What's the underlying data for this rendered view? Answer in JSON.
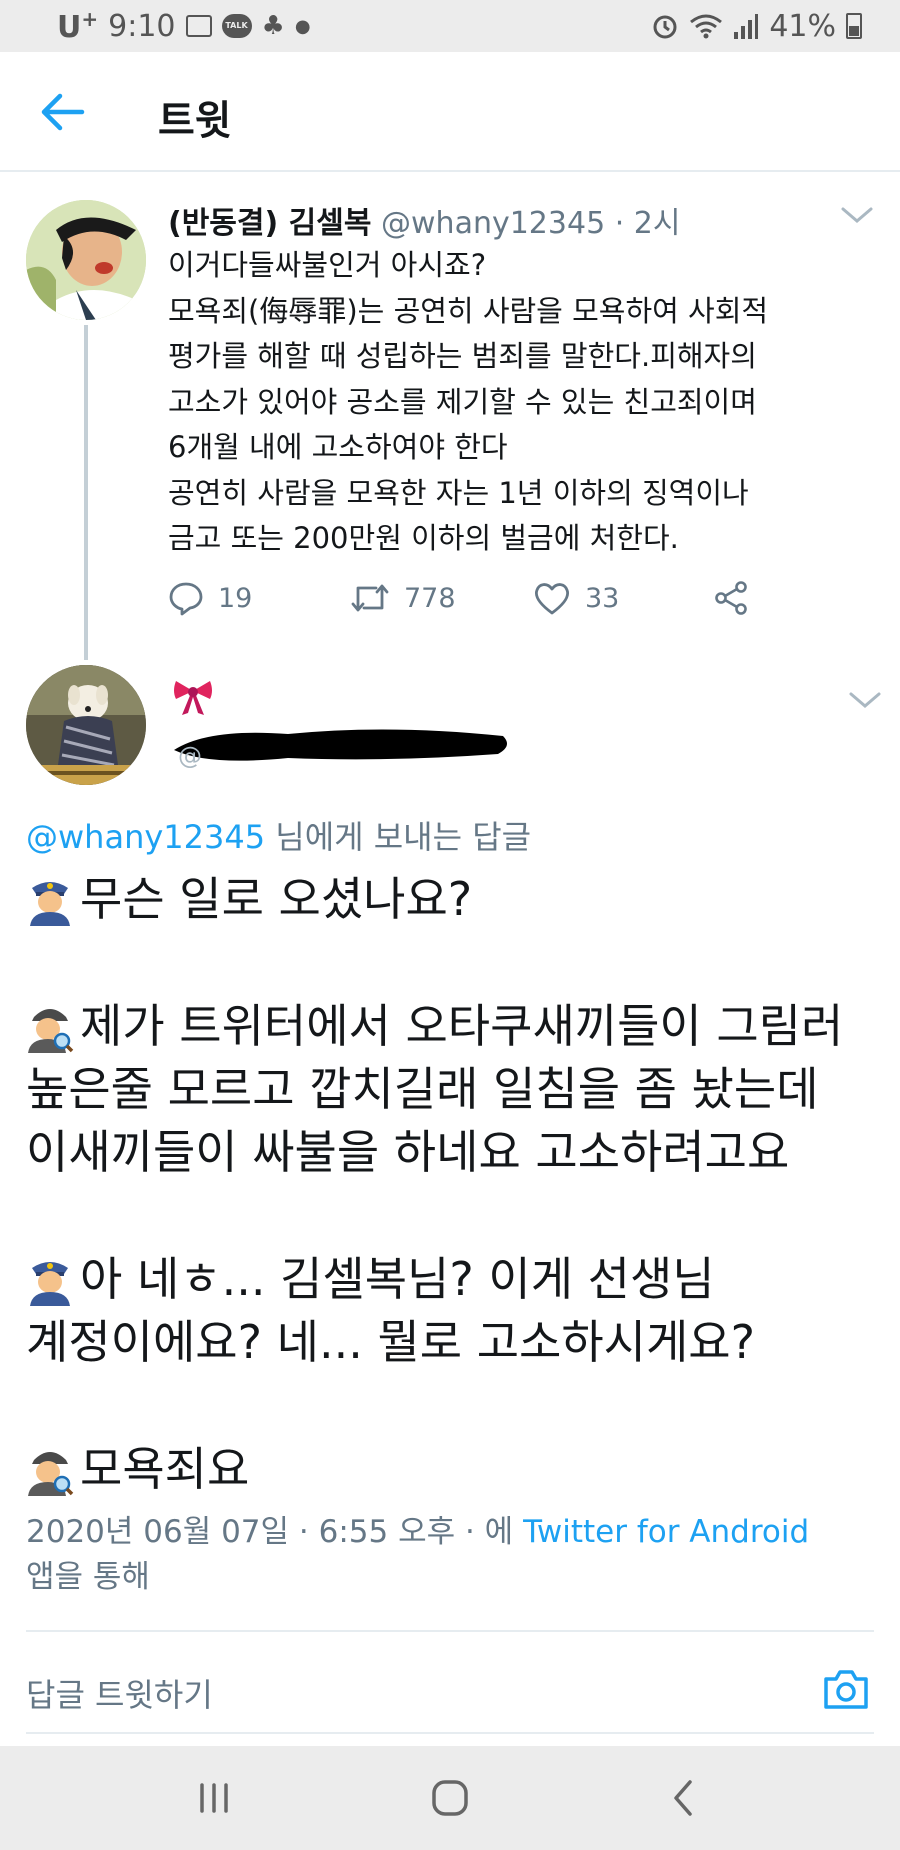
{
  "status_bar": {
    "carrier": "U",
    "carrier_sup": "+",
    "time": "9:10",
    "chat_icon_label": "TALK",
    "battery": "41%",
    "icons_left": [
      "image-icon",
      "kakaotalk-icon",
      "clover-icon",
      "dot-icon"
    ],
    "icons_right": [
      "alarm-icon",
      "wifi-icon",
      "signal-icon",
      "battery-icon"
    ]
  },
  "app_bar": {
    "title": "트윗"
  },
  "tweet": {
    "name": "(반동결) 김셀복",
    "handle": "@whany12345",
    "separator": " · ",
    "time": "2시",
    "lines": [
      "이거다들싸불인거 아시죠?",
      "모욕죄(侮辱罪)는 공연히 사람을 모욕하여 사회적",
      "평가를 해할 때 성립하는 범죄를 말한다.피해자의",
      "고소가 있어야 공소를 제기할 수 있는 친고죄이며",
      "6개월 내에 고소하여야 한다",
      "공연히 사람을 모욕한 자는 1년 이하의 징역이나",
      "금고 또는 200만원 이하의 벌금에 처한다."
    ],
    "replies": "19",
    "retweets": "778",
    "likes": "33"
  },
  "reply": {
    "replying_mention": "@whany12345",
    "replying_text": " 님에게 보내는 답글",
    "lines": [
      {
        "emoji": "police-officer-emoji",
        "text": "무슨 일로 오셨나요?"
      },
      {
        "emoji": "detective-emoji",
        "text": "제가 트위터에서 오타쿠새끼들이 그림러"
      },
      {
        "emoji": "",
        "text": "높은줄 모르고 깝치길래 일침을 좀 놨는데"
      },
      {
        "emoji": "",
        "text": "이새끼들이 싸불을 하네요 고소하려고요"
      },
      {
        "emoji": "police-officer-emoji",
        "text": "아 네ㅎ... 김셀복님? 이게 선생님"
      },
      {
        "emoji": "",
        "text": "계정이에요? 네... 뭘로 고소하시게요?"
      },
      {
        "emoji": "detective-emoji",
        "text": "모욕죄요"
      }
    ],
    "timestamp": "2020년 06월 07일 · 6:55 오후 · 에 ",
    "via": "Twitter for Android",
    "timestamp_suffix": "앱을 통해"
  },
  "compose": {
    "placeholder": "답글 트윗하기"
  },
  "colors": {
    "accent": "#1da1f2",
    "secondary_text": "#657786",
    "primary_text": "#14171a",
    "divider": "#e6ecf0"
  }
}
